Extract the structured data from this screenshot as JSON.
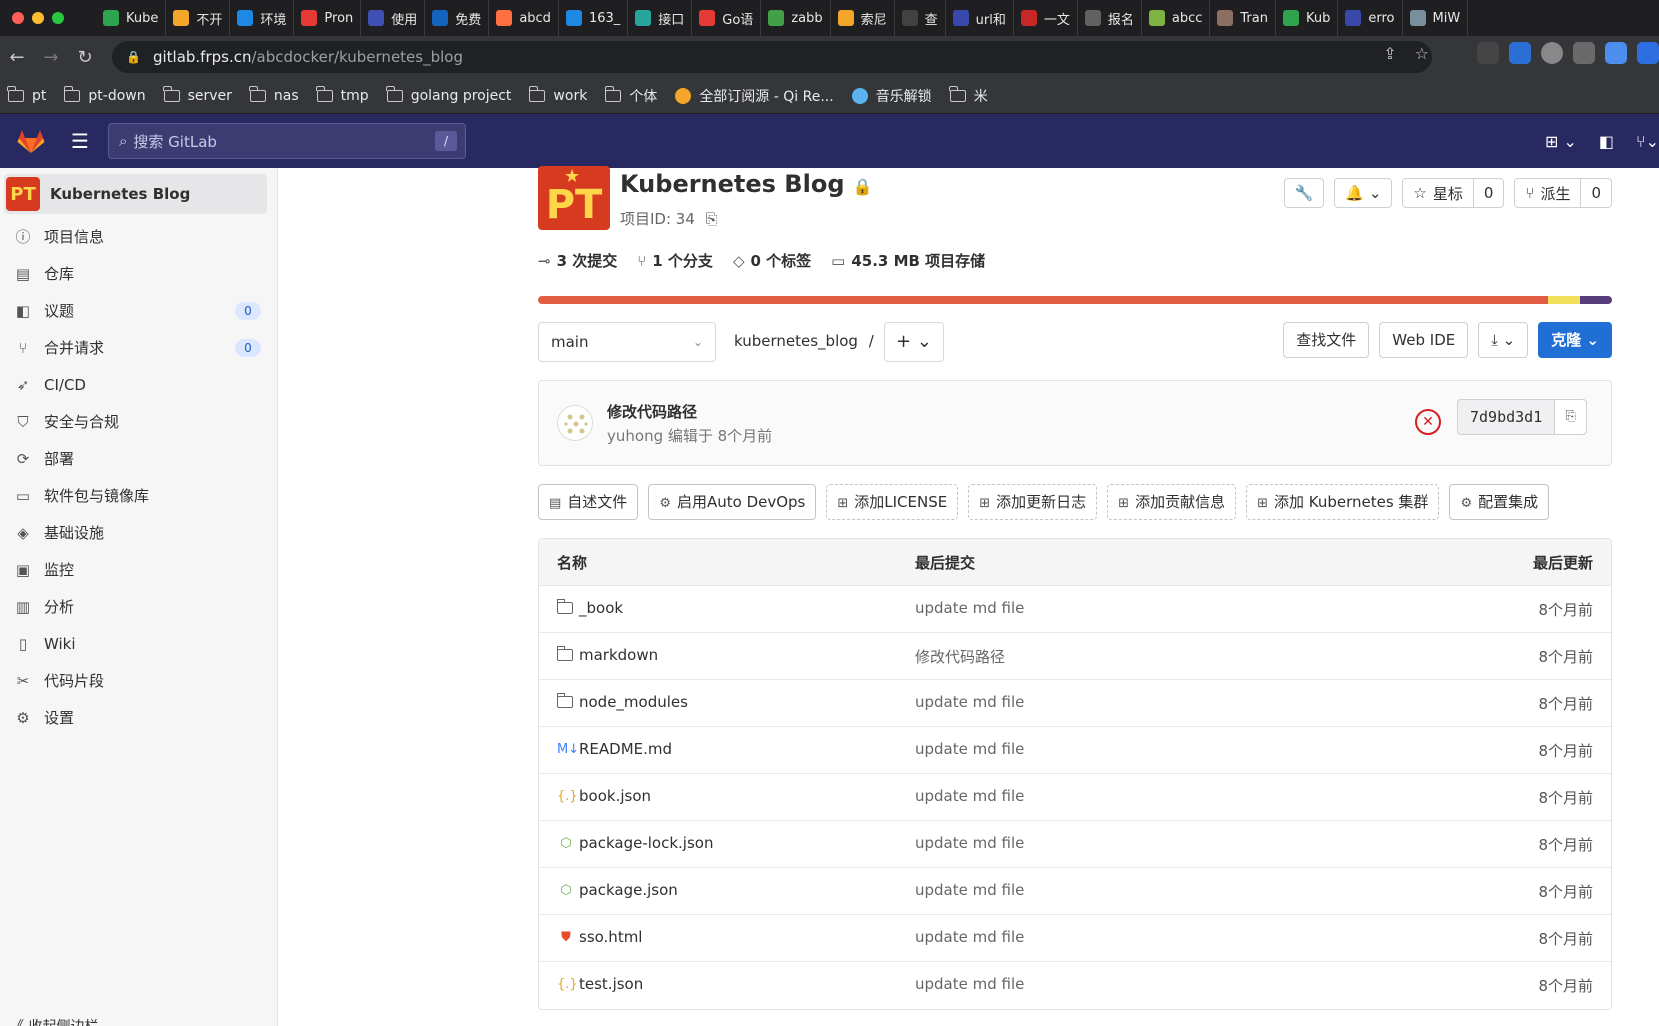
{
  "browser": {
    "tabs": [
      {
        "label": "Kube",
        "color": "#2ea44f"
      },
      {
        "label": "不开",
        "color": "#f4a62a"
      },
      {
        "label": "环境",
        "color": "#1e88e5"
      },
      {
        "label": "Pron",
        "color": "#e53935"
      },
      {
        "label": "使用",
        "color": "#3f51b5"
      },
      {
        "label": "免费",
        "color": "#1565c0"
      },
      {
        "label": "abcd",
        "color": "#ff7043"
      },
      {
        "label": "163_",
        "color": "#1e88e5"
      },
      {
        "label": "接口",
        "color": "#26a69a"
      },
      {
        "label": "Go语",
        "color": "#e53935"
      },
      {
        "label": "zabb",
        "color": "#43a047"
      },
      {
        "label": "索尼",
        "color": "#f4a62a"
      },
      {
        "label": "查",
        "color": "#424242"
      },
      {
        "label": "url和",
        "color": "#3949ab"
      },
      {
        "label": "一文",
        "color": "#c62828"
      },
      {
        "label": "报名",
        "color": "#616161"
      },
      {
        "label": "abcc",
        "color": "#7cb342"
      },
      {
        "label": "Tran",
        "color": "#8d6e63"
      },
      {
        "label": "Kub",
        "color": "#2ea44f"
      },
      {
        "label": "erro",
        "color": "#3949ab"
      },
      {
        "label": "MiW",
        "color": "#78909c"
      }
    ],
    "url_host": "gitlab.frps.cn",
    "url_path": "/abcdocker/kubernetes_blog",
    "bookmarks": [
      {
        "label": "pt",
        "type": "folder"
      },
      {
        "label": "pt-down",
        "type": "folder"
      },
      {
        "label": "server",
        "type": "folder"
      },
      {
        "label": "nas",
        "type": "folder"
      },
      {
        "label": "tmp",
        "type": "folder"
      },
      {
        "label": "golang project",
        "type": "folder"
      },
      {
        "label": "work",
        "type": "folder"
      },
      {
        "label": "个体",
        "type": "folder"
      },
      {
        "label": "全部订阅源 - Qi Re...",
        "type": "rss"
      },
      {
        "label": "音乐解锁",
        "type": "music"
      },
      {
        "label": "米",
        "type": "folder"
      }
    ]
  },
  "gitlab": {
    "search_placeholder": "搜索 GitLab",
    "search_shortcut": "/",
    "brand_color": "#292961"
  },
  "sidebar": {
    "project_name": "Kubernetes Blog",
    "avatar_text": "PT",
    "items": [
      {
        "label": "项目信息",
        "icon": "info-icon",
        "glyph": "ⓘ"
      },
      {
        "label": "仓库",
        "icon": "document-icon",
        "glyph": "▤"
      },
      {
        "label": "议题",
        "icon": "issues-icon",
        "glyph": "◧",
        "badge": "0"
      },
      {
        "label": "合并请求",
        "icon": "merge-request-icon",
        "glyph": "⑂",
        "badge": "0"
      },
      {
        "label": "CI/CD",
        "icon": "rocket-icon",
        "glyph": "➶"
      },
      {
        "label": "安全与合规",
        "icon": "shield-icon",
        "glyph": "⛉"
      },
      {
        "label": "部署",
        "icon": "deploy-icon",
        "glyph": "⟳"
      },
      {
        "label": "软件包与镜像库",
        "icon": "package-icon",
        "glyph": "▭"
      },
      {
        "label": "基础设施",
        "icon": "cloud-icon",
        "glyph": "◈"
      },
      {
        "label": "监控",
        "icon": "monitor-icon",
        "glyph": "▣"
      },
      {
        "label": "分析",
        "icon": "chart-icon",
        "glyph": "▥"
      },
      {
        "label": "Wiki",
        "icon": "book-icon",
        "glyph": "▯"
      },
      {
        "label": "代码片段",
        "icon": "scissors-icon",
        "glyph": "✂"
      },
      {
        "label": "设置",
        "icon": "gear-icon",
        "glyph": "⚙"
      }
    ],
    "collapse_label": "《 收起侧边栏"
  },
  "project": {
    "title": "Kubernetes Blog",
    "id_label": "项目ID: 34",
    "star_label": "星标",
    "star_count": "0",
    "fork_label": "派生",
    "fork_count": "0",
    "stats": {
      "commits": "3 次提交",
      "branches": "1 个分支",
      "tags": "0 个标签",
      "storage": "45.3 MB 项目存储"
    },
    "language_colors": [
      "#e05d44",
      "#f1e05a",
      "#563d7c"
    ],
    "language_fractions": [
      0.94,
      0.03,
      0.03
    ]
  },
  "repo": {
    "branch": "main",
    "path": "kubernetes_blog",
    "path_sep": "/",
    "add_label": "+ ⌄",
    "find_file": "查找文件",
    "web_ide": "Web IDE",
    "download_label": "⤓ ⌄",
    "clone": "克隆 ⌄"
  },
  "last_commit": {
    "title": "修改代码路径",
    "meta": "yuhong 编辑于 8个月前",
    "sha": "7d9bd3d1",
    "status": "failed",
    "status_glyph": "✕"
  },
  "quick_actions": [
    {
      "label": "自述文件",
      "dashed": false,
      "glyph": "▤"
    },
    {
      "label": "启用Auto DevOps",
      "dashed": false,
      "glyph": "⚙"
    },
    {
      "label": "添加LICENSE",
      "dashed": true,
      "glyph": "⊞"
    },
    {
      "label": "添加更新日志",
      "dashed": true,
      "glyph": "⊞"
    },
    {
      "label": "添加贡献信息",
      "dashed": true,
      "glyph": "⊞"
    },
    {
      "label": "添加 Kubernetes 集群",
      "dashed": true,
      "glyph": "⊞"
    },
    {
      "label": "配置集成",
      "dashed": false,
      "glyph": "⚙"
    }
  ],
  "files": {
    "headers": {
      "name": "名称",
      "commit": "最后提交",
      "date": "最后更新"
    },
    "rows": [
      {
        "name": "_book",
        "type": "dir",
        "commit": "update md file",
        "date": "8个月前"
      },
      {
        "name": "markdown",
        "type": "dir",
        "commit": "修改代码路径",
        "date": "8个月前"
      },
      {
        "name": "node_modules",
        "type": "dir",
        "commit": "update md file",
        "date": "8个月前"
      },
      {
        "name": "README.md",
        "type": "markdown",
        "glyph": "M↓",
        "color": "#3b82f6",
        "commit": "update md file",
        "date": "8个月前"
      },
      {
        "name": "book.json",
        "type": "json",
        "glyph": "{.}",
        "color": "#e6a817",
        "commit": "update md file",
        "date": "8个月前"
      },
      {
        "name": "package-lock.json",
        "type": "node",
        "glyph": "⬡",
        "color": "#6cae4a",
        "commit": "update md file",
        "date": "8个月前"
      },
      {
        "name": "package.json",
        "type": "node",
        "glyph": "⬡",
        "color": "#6cae4a",
        "commit": "update md file",
        "date": "8个月前"
      },
      {
        "name": "sso.html",
        "type": "html",
        "glyph": "⛊",
        "color": "#e44d26",
        "commit": "update md file",
        "date": "8个月前"
      },
      {
        "name": "test.json",
        "type": "json",
        "glyph": "{.}",
        "color": "#e6a817",
        "commit": "update md file",
        "date": "8个月前"
      }
    ]
  }
}
